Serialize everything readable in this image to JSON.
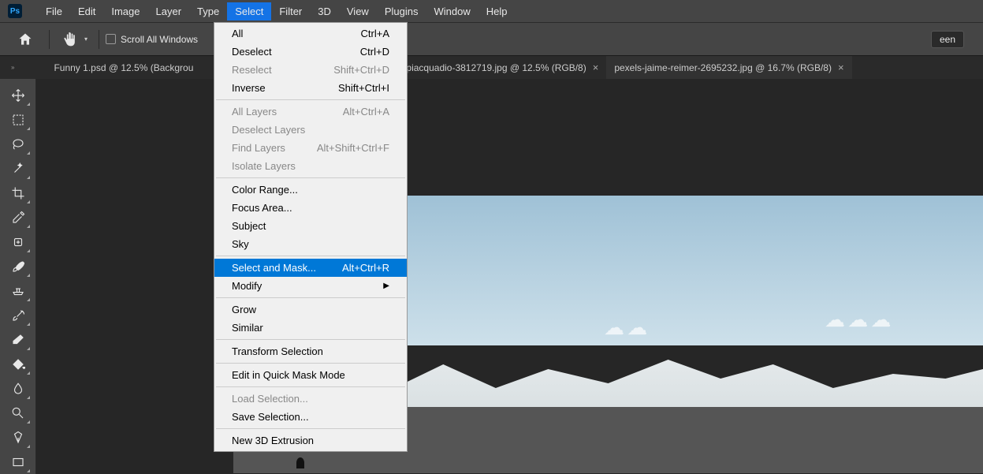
{
  "menubar": {
    "items": [
      "File",
      "Edit",
      "Image",
      "Layer",
      "Type",
      "Select",
      "Filter",
      "3D",
      "View",
      "Plugins",
      "Window",
      "Help"
    ],
    "open_index": 5
  },
  "toolbar": {
    "scroll_all_windows": "Scroll All Windows",
    "fit_screen_fragment": "een"
  },
  "tabs": [
    {
      "label": "Funny 1.psd @ 12.5% (Backgrou",
      "active": false,
      "truncated": true
    },
    {
      "label": "-piacquadio-3812719.jpg @ 12.5% (RGB/8)",
      "active": false,
      "truncated": false
    },
    {
      "label": "pexels-jaime-reimer-2695232.jpg @ 16.7% (RGB/8)",
      "active": true,
      "truncated": false
    }
  ],
  "select_menu": {
    "groups": [
      [
        {
          "label": "All",
          "shortcut": "Ctrl+A",
          "enabled": true
        },
        {
          "label": "Deselect",
          "shortcut": "Ctrl+D",
          "enabled": true
        },
        {
          "label": "Reselect",
          "shortcut": "Shift+Ctrl+D",
          "enabled": false
        },
        {
          "label": "Inverse",
          "shortcut": "Shift+Ctrl+I",
          "enabled": true
        }
      ],
      [
        {
          "label": "All Layers",
          "shortcut": "Alt+Ctrl+A",
          "enabled": false
        },
        {
          "label": "Deselect Layers",
          "shortcut": "",
          "enabled": false
        },
        {
          "label": "Find Layers",
          "shortcut": "Alt+Shift+Ctrl+F",
          "enabled": false
        },
        {
          "label": "Isolate Layers",
          "shortcut": "",
          "enabled": false
        }
      ],
      [
        {
          "label": "Color Range...",
          "shortcut": "",
          "enabled": true
        },
        {
          "label": "Focus Area...",
          "shortcut": "",
          "enabled": true
        },
        {
          "label": "Subject",
          "shortcut": "",
          "enabled": true
        },
        {
          "label": "Sky",
          "shortcut": "",
          "enabled": true
        }
      ],
      [
        {
          "label": "Select and Mask...",
          "shortcut": "Alt+Ctrl+R",
          "enabled": true,
          "hover": true
        },
        {
          "label": "Modify",
          "shortcut": "",
          "enabled": true,
          "submenu": true
        }
      ],
      [
        {
          "label": "Grow",
          "shortcut": "",
          "enabled": true
        },
        {
          "label": "Similar",
          "shortcut": "",
          "enabled": true
        }
      ],
      [
        {
          "label": "Transform Selection",
          "shortcut": "",
          "enabled": true
        }
      ],
      [
        {
          "label": "Edit in Quick Mask Mode",
          "shortcut": "",
          "enabled": true
        }
      ],
      [
        {
          "label": "Load Selection...",
          "shortcut": "",
          "enabled": false
        },
        {
          "label": "Save Selection...",
          "shortcut": "",
          "enabled": true
        }
      ],
      [
        {
          "label": "New 3D Extrusion",
          "shortcut": "",
          "enabled": true
        }
      ]
    ]
  },
  "tools": [
    "move-tool",
    "marquee-tool",
    "lasso-tool",
    "magic-wand-tool",
    "crop-tool",
    "eyedropper-tool",
    "healing-brush-tool",
    "brush-tool",
    "clone-stamp-tool",
    "history-brush-tool",
    "eraser-tool",
    "paint-bucket-tool",
    "blur-tool",
    "dodge-tool",
    "pen-tool",
    "rectangle-tool"
  ],
  "ps_logo": "Ps"
}
